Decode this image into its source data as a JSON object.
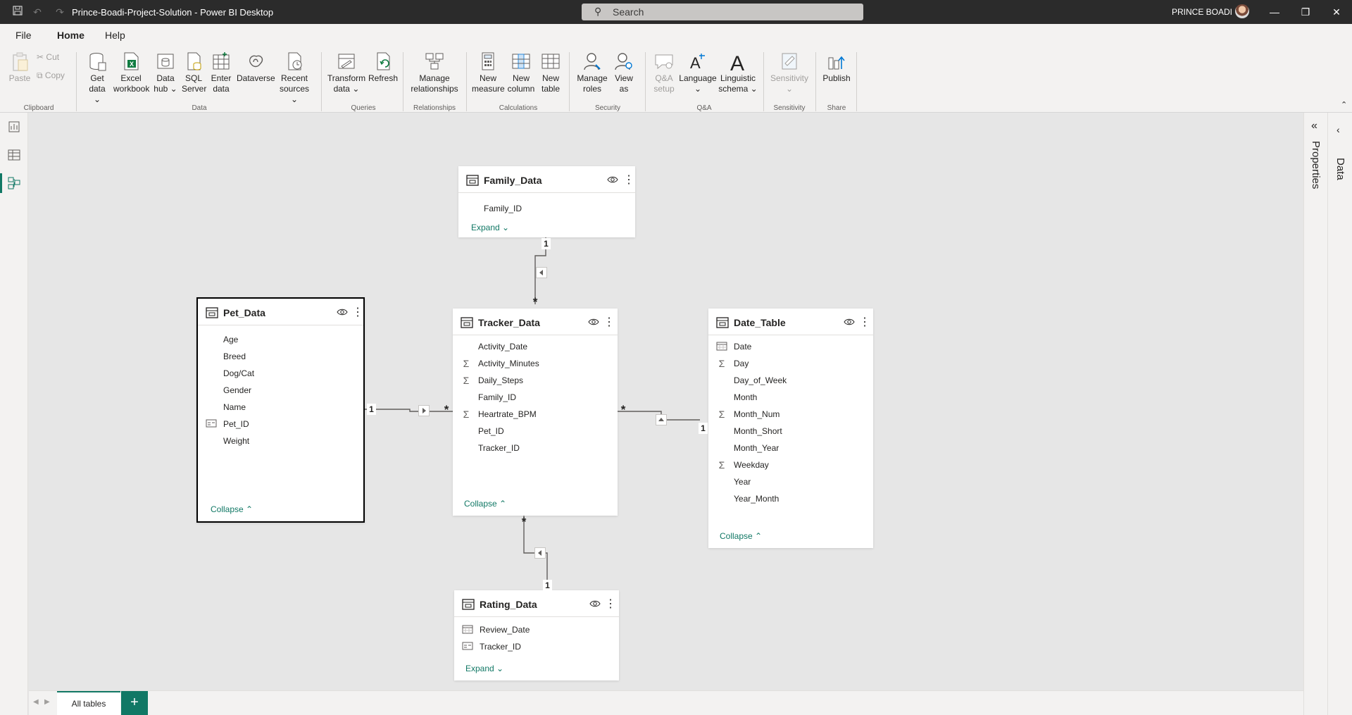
{
  "app": {
    "title": "Prince-Boadi-Project-Solution - Power BI Desktop",
    "user": "PRINCE BOADI",
    "search_placeholder": "Search",
    "accent_color": "#117865"
  },
  "menu": {
    "tabs": [
      {
        "label": "File"
      },
      {
        "label": "Home",
        "active": true
      },
      {
        "label": "Help"
      }
    ]
  },
  "ribbon": {
    "clipboard": {
      "paste": "Paste",
      "cut": "Cut",
      "copy": "Copy",
      "group": "Clipboard"
    },
    "data": {
      "get_data": [
        "Get",
        "data"
      ],
      "excel": [
        "Excel",
        "workbook"
      ],
      "data_hub": [
        "Data",
        "hub"
      ],
      "sql": [
        "SQL",
        "Server"
      ],
      "enter": [
        "Enter",
        "data"
      ],
      "dataverse": "Dataverse",
      "recent": [
        "Recent",
        "sources"
      ],
      "group": "Data"
    },
    "queries": {
      "transform": [
        "Transform",
        "data"
      ],
      "refresh": "Refresh",
      "group": "Queries"
    },
    "relationships": {
      "manage": [
        "Manage",
        "relationships"
      ],
      "group": "Relationships"
    },
    "calculations": {
      "measure": [
        "New",
        "measure"
      ],
      "column": [
        "New",
        "column"
      ],
      "table": [
        "New",
        "table"
      ],
      "group": "Calculations"
    },
    "security": {
      "roles": [
        "Manage",
        "roles"
      ],
      "view_as": [
        "View",
        "as"
      ],
      "group": "Security"
    },
    "qa": {
      "setup": [
        "Q&A",
        "setup"
      ],
      "language": "Language",
      "schema": [
        "Linguistic",
        "schema"
      ],
      "group": "Q&A"
    },
    "sensitivity": {
      "label": "Sensitivity",
      "group": "Sensitivity"
    },
    "share": {
      "publish": "Publish",
      "group": "Share"
    }
  },
  "panes": {
    "properties": "Properties",
    "data": "Data"
  },
  "tables": {
    "family": {
      "name": "Family_Data",
      "fields": [
        {
          "label": "Family_ID",
          "icon": ""
        }
      ],
      "toggle": "Expand"
    },
    "pet": {
      "name": "Pet_Data",
      "fields": [
        {
          "label": "Age",
          "icon": ""
        },
        {
          "label": "Breed",
          "icon": ""
        },
        {
          "label": "Dog/Cat",
          "icon": ""
        },
        {
          "label": "Gender",
          "icon": ""
        },
        {
          "label": "Name",
          "icon": ""
        },
        {
          "label": "Pet_ID",
          "icon": "id-card-icon"
        },
        {
          "label": "Weight",
          "icon": ""
        }
      ],
      "toggle": "Collapse"
    },
    "tracker": {
      "name": "Tracker_Data",
      "fields": [
        {
          "label": "Activity_Date",
          "icon": ""
        },
        {
          "label": "Activity_Minutes",
          "icon": "sigma-icon"
        },
        {
          "label": "Daily_Steps",
          "icon": "sigma-icon"
        },
        {
          "label": "Family_ID",
          "icon": ""
        },
        {
          "label": "Heartrate_BPM",
          "icon": "sigma-icon"
        },
        {
          "label": "Pet_ID",
          "icon": ""
        },
        {
          "label": "Tracker_ID",
          "icon": ""
        }
      ],
      "toggle": "Collapse"
    },
    "date": {
      "name": "Date_Table",
      "fields": [
        {
          "label": "Date",
          "icon": "calendar-icon"
        },
        {
          "label": "Day",
          "icon": "sigma-icon"
        },
        {
          "label": "Day_of_Week",
          "icon": ""
        },
        {
          "label": "Month",
          "icon": ""
        },
        {
          "label": "Month_Num",
          "icon": "sigma-icon"
        },
        {
          "label": "Month_Short",
          "icon": ""
        },
        {
          "label": "Month_Year",
          "icon": ""
        },
        {
          "label": "Weekday",
          "icon": "sigma-icon"
        },
        {
          "label": "Year",
          "icon": ""
        },
        {
          "label": "Year_Month",
          "icon": ""
        }
      ],
      "toggle": "Collapse"
    },
    "rating": {
      "name": "Rating_Data",
      "fields": [
        {
          "label": "Review_Date",
          "icon": "calendar-icon"
        },
        {
          "label": "Tracker_ID",
          "icon": "id-card-icon"
        }
      ],
      "toggle": "Expand"
    }
  },
  "relationships": {
    "one": "1",
    "many": "*"
  },
  "bottom": {
    "page_tab": "All tables",
    "add": "+"
  }
}
